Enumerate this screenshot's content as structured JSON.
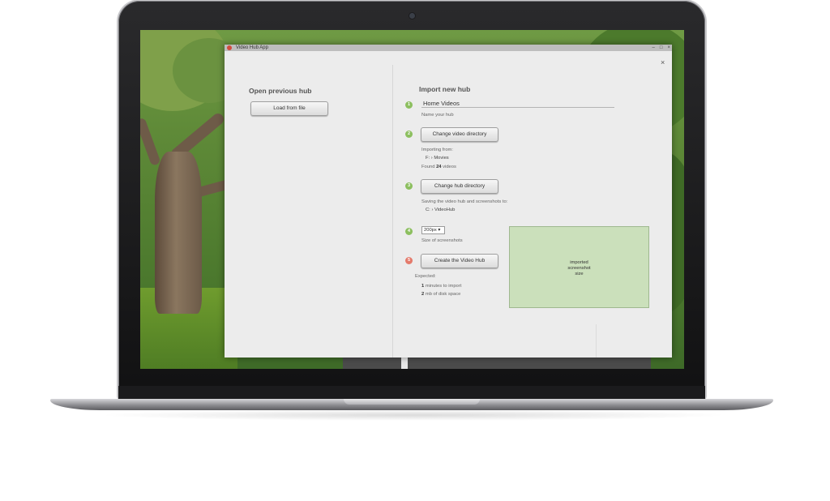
{
  "window": {
    "title": "Video Hub App",
    "controls": [
      "–",
      "□",
      "×"
    ],
    "close_label": "×"
  },
  "left": {
    "title": "Open previous hub",
    "load_label": "Load from file"
  },
  "right": {
    "title": "Import new hub",
    "steps": [
      "1",
      "2",
      "3",
      "4",
      "5"
    ],
    "hub_name": {
      "value": "Home Videos",
      "caption": "Name your hub"
    },
    "video_dir": {
      "button": "Change video directory",
      "importing_from": "Importing from:",
      "drive": "F:",
      "sep": "›",
      "folder": "Movies",
      "found_prefix": "Found",
      "found_count": "24",
      "found_suffix": "videos"
    },
    "hub_dir": {
      "button": "Change hub directory",
      "saving_to": "Saving the video hub and screenshots to:",
      "drive": "C:",
      "sep": "›",
      "folder": "VideoHub"
    },
    "screenshot": {
      "size_value": "200px",
      "arrow": "▾",
      "caption": "Size of screenshots"
    },
    "create": {
      "button": "Create the Video Hub",
      "expected": "Expected:",
      "minutes_value": "1",
      "minutes_text": "minutes to import",
      "mb_value": "2",
      "mb_text": "mb of disk space"
    },
    "preview_lines": [
      "imported",
      "screenshot",
      "size"
    ]
  },
  "colors": {
    "step_green": "#8cbf5f",
    "step_red": "#e47a6b",
    "preview_fill": "#cbe0bb"
  },
  "icons": {
    "app": "app-logo-icon",
    "close": "close-icon"
  }
}
